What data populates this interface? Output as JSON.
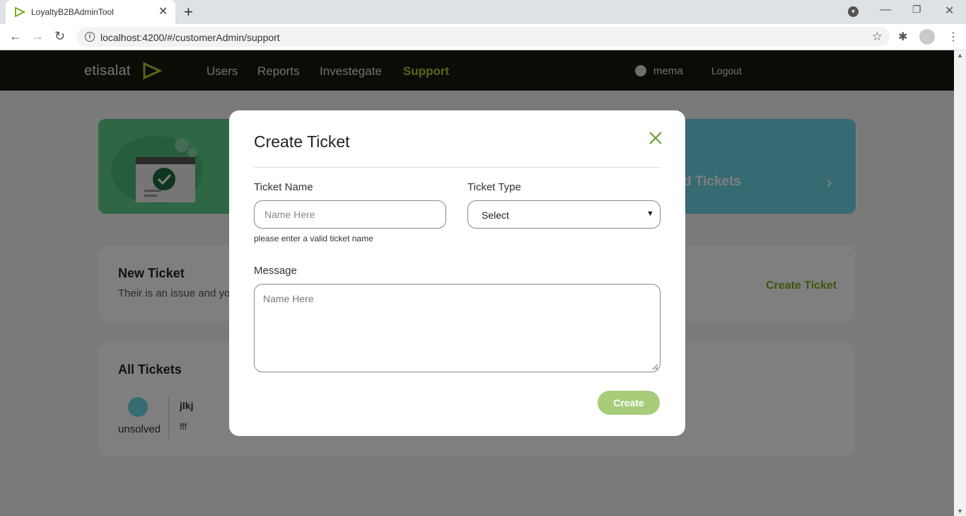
{
  "browser": {
    "tab_title": "LoyaltyB2BAdminTool",
    "url": "localhost:4200/#/customerAdmin/support"
  },
  "navbar": {
    "logo_text": "etisalat",
    "items": [
      {
        "label": "Users"
      },
      {
        "label": "Reports"
      },
      {
        "label": "Investegate"
      },
      {
        "label": "Support"
      }
    ],
    "active_item": "Support",
    "user_name": "mema",
    "logout_label": "Logout"
  },
  "banners": {
    "right_text": "d Tickets"
  },
  "new_ticket_card": {
    "title": "New Ticket",
    "subtitle": "Their is an issue and yo",
    "action_label": "Create Ticket"
  },
  "all_tickets_card": {
    "title": "All Tickets",
    "tickets": [
      {
        "name": "jlkj",
        "description": "fff",
        "status": "unsolved"
      }
    ]
  },
  "modal": {
    "title": "Create Ticket",
    "ticket_name_label": "Ticket Name",
    "ticket_name_placeholder": "Name Here",
    "ticket_name_value": "",
    "ticket_name_error": "please enter a valid ticket name",
    "ticket_type_label": "Ticket Type",
    "ticket_type_selected": "Select",
    "message_label": "Message",
    "message_placeholder": "Name Here",
    "create_label": "Create"
  },
  "colors": {
    "nav_bg": "#151a0c",
    "accent_green": "#b8c73a",
    "link_green": "#7cab1f",
    "button_green": "#a7cc7a",
    "close_icon": "#6b9a2a"
  }
}
